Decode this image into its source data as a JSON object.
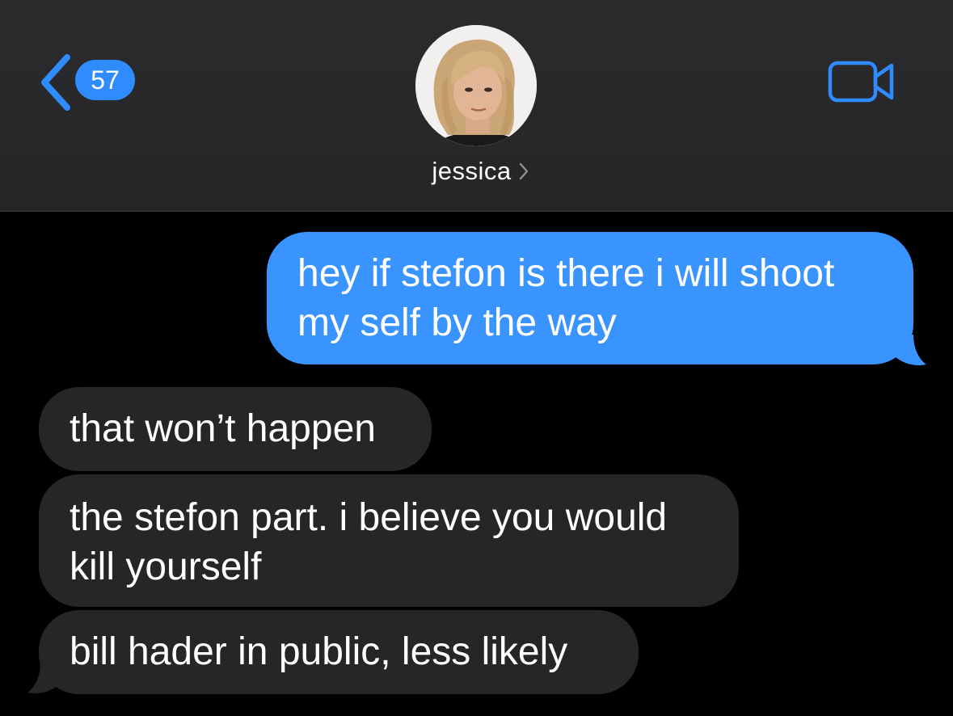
{
  "header": {
    "back_badge": "57",
    "contact_name": "jessica",
    "icons": {
      "back": "chevron-left-icon",
      "contact_more": "chevron-right-icon",
      "video": "video-camera-icon"
    }
  },
  "colors": {
    "header_bg": "#2a2a2c",
    "screen_bg": "#000000",
    "accent": "#2f8cff",
    "sent_bubble": "#3a94ff",
    "received_bubble": "#262628",
    "text": "#ffffff"
  },
  "messages": [
    {
      "direction": "sent",
      "lines": [
        "hey if stefon is there i will shoot",
        "my self by the way"
      ]
    },
    {
      "direction": "received",
      "lines": [
        "that won’t happen"
      ]
    },
    {
      "direction": "received",
      "lines": [
        "the stefon part. i believe you would",
        "kill yourself"
      ]
    },
    {
      "direction": "received",
      "lines": [
        "bill hader in public, less likely"
      ]
    }
  ]
}
